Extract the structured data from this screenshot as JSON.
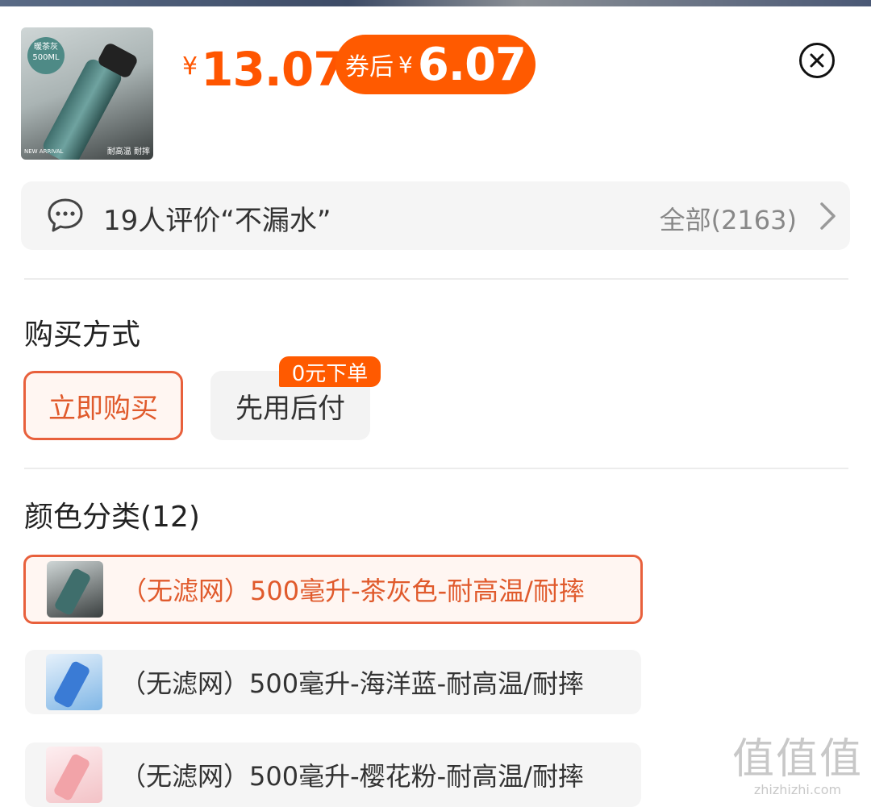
{
  "product": {
    "thumb_badge": "暖茶灰\n500ML",
    "thumb_tag_left": "NEW ARRIVAL",
    "thumb_tag_right": "耐高温 耐摔",
    "price_symbol": "¥",
    "price": "13.07",
    "coupon_label": "券后",
    "coupon_symbol": "¥",
    "coupon_price": "6.07"
  },
  "reviews": {
    "icon": "chat-bubble-icon",
    "summary": "19人评价“不漏水”",
    "all_label": "全部(2163)"
  },
  "purchase": {
    "title": "购买方式",
    "options": [
      {
        "label": "立即购买",
        "selected": true
      },
      {
        "label": "先用后付",
        "selected": false
      }
    ],
    "badge": "0元下单"
  },
  "colors": {
    "title": "颜色分类(12)",
    "items": [
      {
        "label": "（无滤网）500毫升-茶灰色-耐高温/耐摔",
        "selected": true,
        "color": "#3f6e6c"
      },
      {
        "label": "（无滤网）500毫升-海洋蓝-耐高温/耐摔",
        "selected": false,
        "color": "#3a7bd5"
      },
      {
        "label": "（无滤网）500毫升-樱花粉-耐高温/耐摔",
        "selected": false,
        "color": "#f2a3a8"
      }
    ]
  },
  "theme": {
    "accent": "#ff5a00",
    "selected_border": "#e8603c"
  },
  "watermark": {
    "big": "值值值",
    "small": "zhizhizhi.com"
  }
}
